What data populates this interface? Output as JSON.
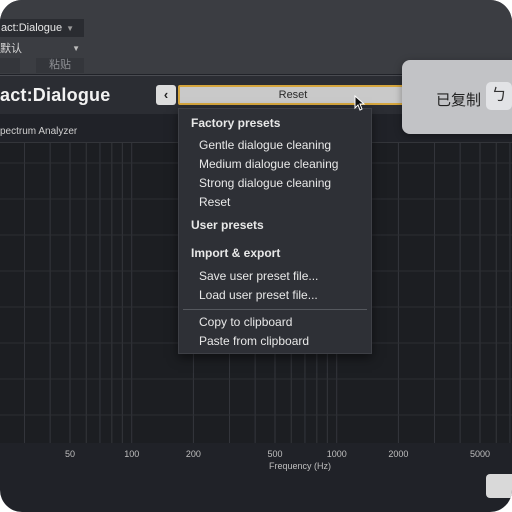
{
  "host": {
    "tab_label": "act:Dialogue",
    "tab_arrow": "▼",
    "preset_value": "默认",
    "preset_arrow": "▼",
    "buttons": [
      "",
      "粘贴"
    ]
  },
  "plugin": {
    "title": "act:Dialogue",
    "prev_glyph": "‹",
    "current_preset": "Reset"
  },
  "toast": {
    "text": "已复制",
    "icon_glyph": "ㄅ"
  },
  "analyzer": {
    "label": "pectrum Analyzer",
    "x_axis_title": "Frequency (Hz)",
    "ticks": [
      "50",
      "100",
      "200",
      "500",
      "1000",
      "2000",
      "5000"
    ]
  },
  "menu": {
    "factory_header": "Factory presets",
    "factory_items": [
      "Gentle dialogue cleaning",
      "Medium dialogue cleaning",
      "Strong dialogue cleaning",
      "Reset"
    ],
    "user_header": "User presets",
    "import_header": "Import & export",
    "import_items": [
      "Save user preset file...",
      "Load user preset file..."
    ],
    "clipboard_items": [
      "Copy to clipboard",
      "Paste from clipboard"
    ]
  },
  "colors": {
    "accent_border": "#d6a63e",
    "panel_bg": "#202228",
    "menu_bg": "#2e3036"
  }
}
